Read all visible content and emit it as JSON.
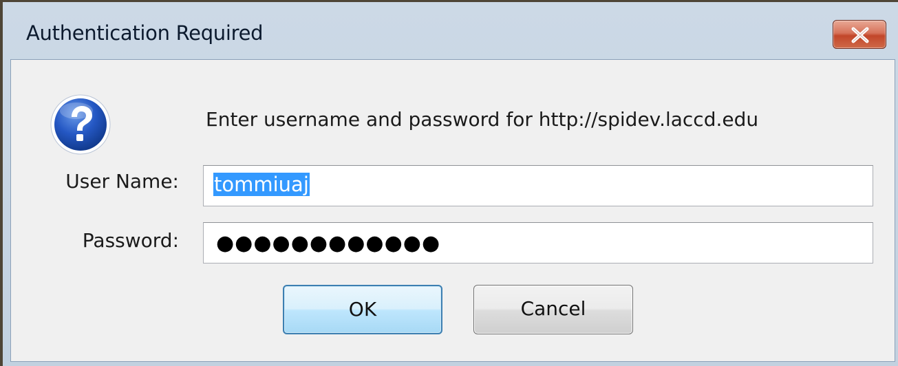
{
  "window": {
    "title": "Authentication Required",
    "close_icon": "close-icon"
  },
  "dialog": {
    "icon": "help-question-icon",
    "prompt": "Enter username and password for http://spidev.laccd.edu",
    "username_label": "User Name:",
    "username_value": "tommiuaj",
    "password_label": "Password:",
    "password_mask": "●●●●●●●●●●●●",
    "ok_label": "OK",
    "cancel_label": "Cancel"
  },
  "colors": {
    "accent": "#3399ff",
    "close_red": "#c2462a"
  }
}
